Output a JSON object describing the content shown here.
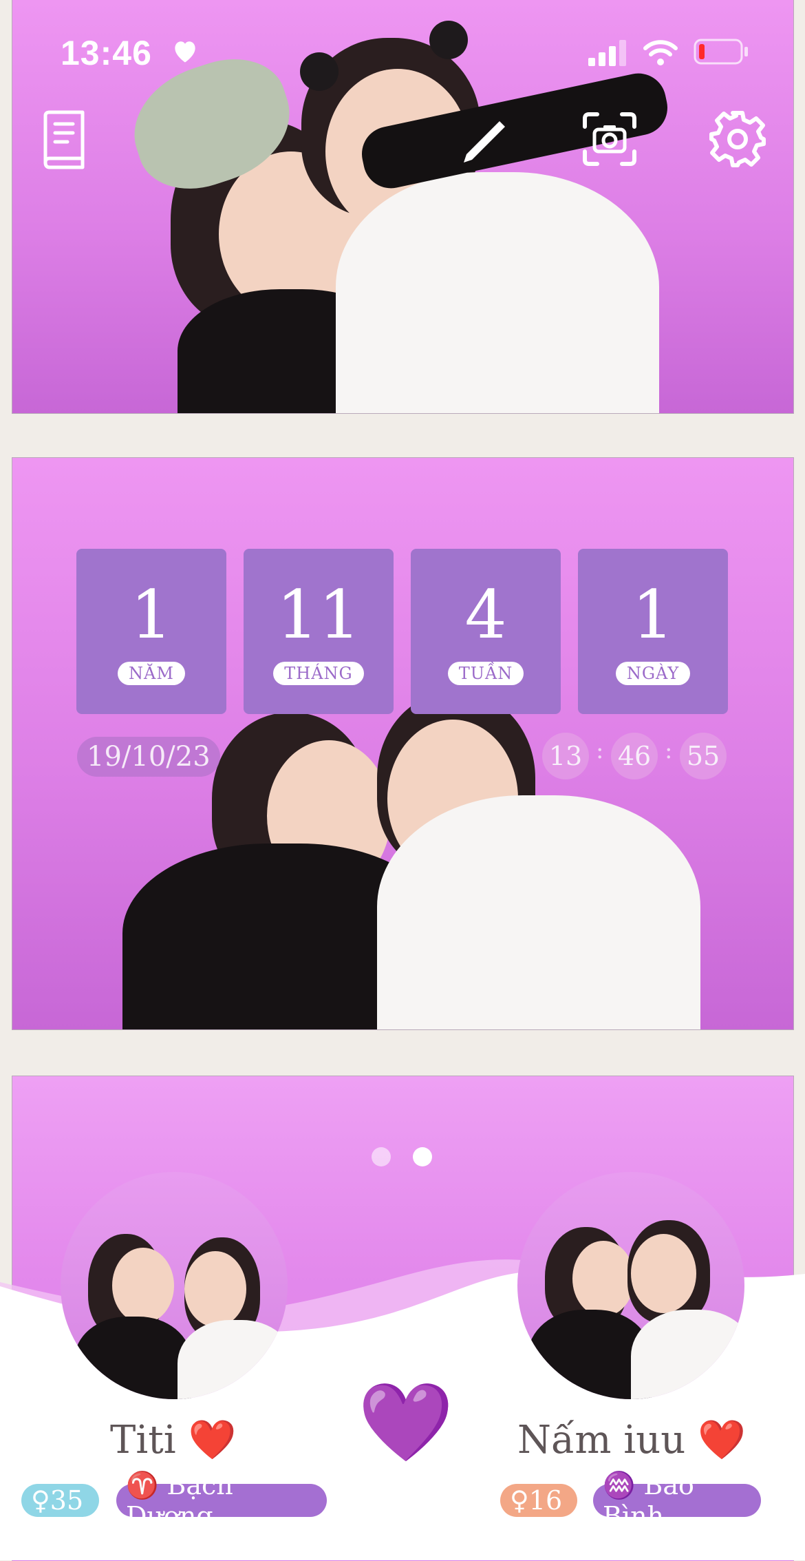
{
  "status_bar": {
    "time": "13:46",
    "icons": [
      "heart-icon",
      "cellular-signal-icon",
      "wifi-icon",
      "battery-low-icon"
    ]
  },
  "toolbar": {
    "icons": [
      "book-icon",
      "pen-icon",
      "camera-frame-icon",
      "gear-icon"
    ]
  },
  "counter": {
    "tiles": [
      {
        "value": "1",
        "label": "NĂM"
      },
      {
        "value": "11",
        "label": "THÁNG"
      },
      {
        "value": "4",
        "label": "TUẦN"
      },
      {
        "value": "1",
        "label": "NGÀY"
      }
    ],
    "start_date": "19/10/23",
    "clock": {
      "hours": "13",
      "minutes": "46",
      "seconds": "55"
    }
  },
  "carousel": {
    "page_count": 2,
    "active_page": 2
  },
  "couple": {
    "left": {
      "name": "Titi ❤️",
      "age_badge": "♀35",
      "zodiac_badge": "♈ Bạch Dương"
    },
    "center_icon": "💜",
    "right": {
      "name": "Nấm iuu ❤️",
      "age_badge": "♀16",
      "zodiac_badge": "♒ Bảo Bình"
    }
  },
  "colors": {
    "panel_pink": "#e78ced",
    "tile_purple": "#a074cd",
    "badge_cyan": "#8fd6e6",
    "badge_purple": "#a46fd2",
    "badge_orange": "#f3a786"
  }
}
